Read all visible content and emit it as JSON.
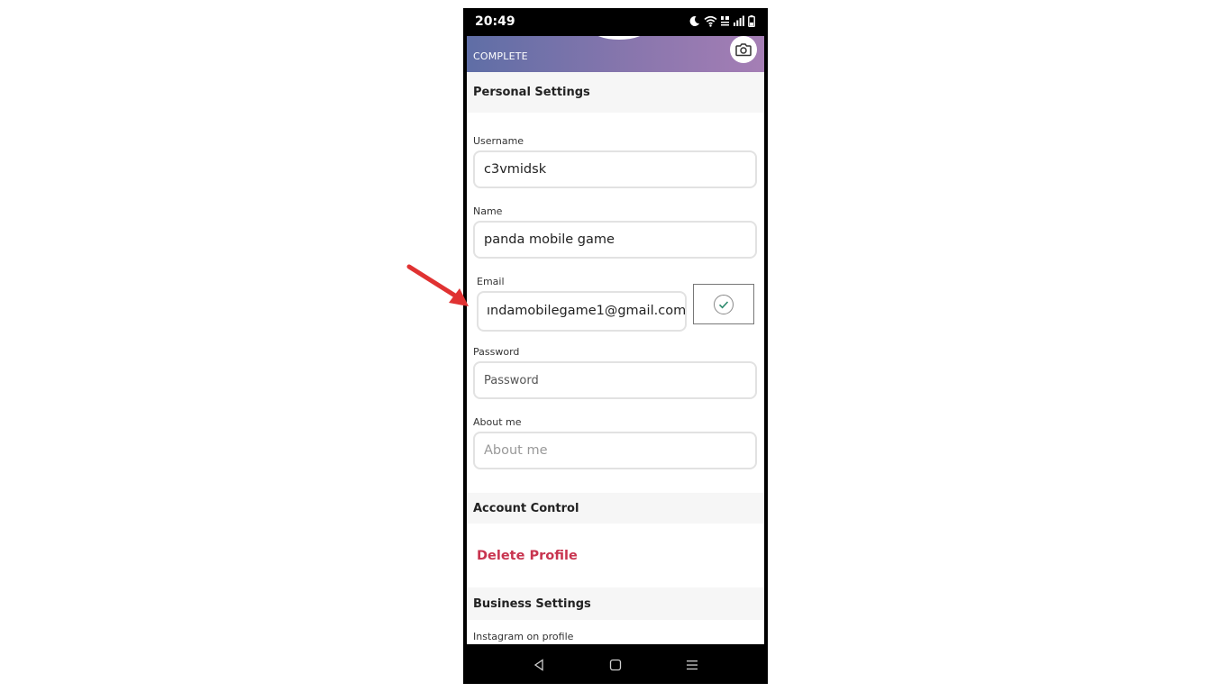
{
  "status_bar": {
    "time": "20:49"
  },
  "banner": {
    "label": "COMPLETE"
  },
  "sections": {
    "personal_settings": "Personal Settings",
    "account_control": "Account Control",
    "business_settings": "Business Settings"
  },
  "fields": {
    "username": {
      "label": "Username",
      "value": "c3vmidsk"
    },
    "name": {
      "label": "Name",
      "value": "panda mobile game"
    },
    "email": {
      "label": "Email",
      "value": "ındamobilegame1@gmail.com"
    },
    "password": {
      "label": "Password",
      "placeholder": "Password"
    },
    "about_me": {
      "label": "About me",
      "placeholder": "About me"
    },
    "instagram": {
      "label": "Instagram on profile"
    }
  },
  "account_control": {
    "delete_label": "Delete Profile"
  },
  "icons": {
    "camera": "camera-icon",
    "verify": "check-circle-icon",
    "nav_back": "back-triangle-icon",
    "nav_home": "home-square-icon",
    "nav_menu": "menu-lines-icon",
    "annotation": "red-arrow"
  },
  "colors": {
    "accent_red": "#c8344f",
    "annotation_arrow": "#e03232",
    "banner_start": "#5f6ea6",
    "banner_end": "#a57eb5",
    "verify_check": "#2e8b6e"
  }
}
